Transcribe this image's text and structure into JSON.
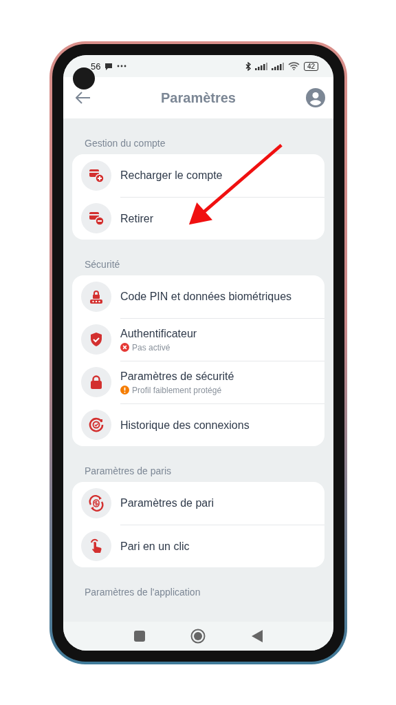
{
  "status_bar": {
    "time": "56",
    "battery": "42"
  },
  "header": {
    "title": "Paramètres"
  },
  "sections": [
    {
      "title": "Gestion du compte",
      "items": [
        {
          "label": "Recharger le compte"
        },
        {
          "label": "Retirer"
        }
      ]
    },
    {
      "title": "Sécurité",
      "items": [
        {
          "label": "Code PIN et données biométriques"
        },
        {
          "label": "Authentificateur",
          "status": {
            "text": "Pas activé",
            "kind": "error"
          }
        },
        {
          "label": "Paramètres de sécurité",
          "status": {
            "text": "Profil faiblement protégé",
            "kind": "warning"
          }
        },
        {
          "label": "Historique des connexions"
        }
      ]
    },
    {
      "title": "Paramètres de paris",
      "items": [
        {
          "label": "Paramètres de pari"
        },
        {
          "label": "Pari en un clic"
        }
      ]
    },
    {
      "title": "Paramètres de l'application"
    }
  ]
}
